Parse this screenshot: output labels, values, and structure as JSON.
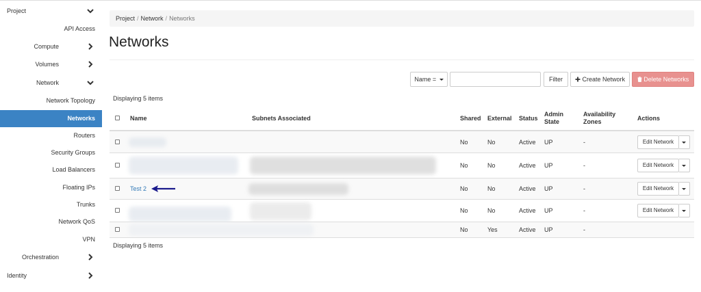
{
  "sidebar": {
    "project_label": "Project",
    "api_access": "API Access",
    "compute": "Compute",
    "volumes": "Volumes",
    "network": "Network",
    "network_topology": "Network Topology",
    "networks": "Networks",
    "routers": "Routers",
    "security_groups": "Security Groups",
    "load_balancers": "Load Balancers",
    "floating_ips": "Floating IPs",
    "trunks": "Trunks",
    "network_qos": "Network QoS",
    "vpn": "VPN",
    "orchestration": "Orchestration",
    "identity": "Identity"
  },
  "breadcrumb": {
    "project": "Project",
    "network": "Network",
    "current": "Networks",
    "sep": "/"
  },
  "page": {
    "title": "Networks"
  },
  "toolbar": {
    "filter_field": "Name =",
    "filter_input_value": "",
    "filter_button": "Filter",
    "create_button": "Create Network",
    "delete_button": "Delete Networks"
  },
  "display_count": "Displaying 5 items",
  "table": {
    "headers": {
      "name": "Name",
      "subnets": "Subnets Associated",
      "shared": "Shared",
      "external": "External",
      "status": "Status",
      "admin_state_1": "Admin",
      "admin_state_2": "State",
      "availability_zones_1": "Availability",
      "availability_zones_2": "Zones",
      "actions": "Actions"
    },
    "rows": [
      {
        "name": "",
        "shared": "No",
        "external": "No",
        "status": "Active",
        "admin_state": "UP",
        "zones": "-",
        "action": "Edit Network"
      },
      {
        "name": "",
        "shared": "No",
        "external": "No",
        "status": "Active",
        "admin_state": "UP",
        "zones": "-",
        "action": "Edit Network"
      },
      {
        "name": "Test 2",
        "shared": "No",
        "external": "No",
        "status": "Active",
        "admin_state": "UP",
        "zones": "-",
        "action": "Edit Network"
      },
      {
        "name": "",
        "shared": "No",
        "external": "No",
        "status": "Active",
        "admin_state": "UP",
        "zones": "-",
        "action": "Edit Network"
      },
      {
        "name": "",
        "shared": "No",
        "external": "Yes",
        "status": "Active",
        "admin_state": "UP",
        "zones": "-",
        "action": ""
      }
    ]
  },
  "colors": {
    "accent": "#3b83c4",
    "danger": "#e8918f",
    "link": "#337ab7",
    "arrow": "#1a1a8c"
  },
  "icons": {
    "expanded": "chevron-down-icon",
    "collapsed": "chevron-right-icon",
    "arrow": "left-arrow-icon",
    "plus": "plus-icon",
    "trash": "trash-icon",
    "caret": "caret-down-icon"
  }
}
